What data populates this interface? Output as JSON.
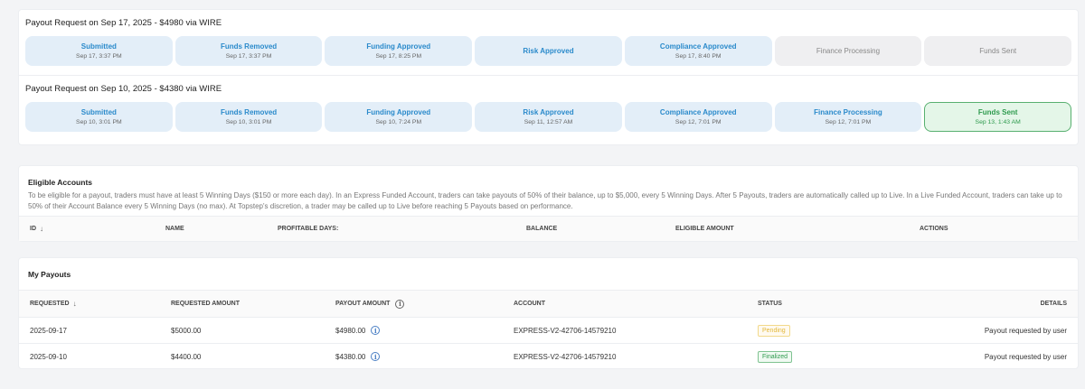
{
  "payout_requests": [
    {
      "title": "Payout Request on Sep 17, 2025 - $4980 via WIRE",
      "steps": [
        {
          "label": "Submitted",
          "date": "Sep 17, 3:37 PM",
          "state": "done"
        },
        {
          "label": "Funds Removed",
          "date": "Sep 17, 3:37 PM",
          "state": "done"
        },
        {
          "label": "Funding Approved",
          "date": "Sep 17, 8:25 PM",
          "state": "done"
        },
        {
          "label": "Risk Approved",
          "date": "",
          "state": "done"
        },
        {
          "label": "Compliance Approved",
          "date": "Sep 17, 8:40 PM",
          "state": "done"
        },
        {
          "label": "Finance Processing",
          "date": "",
          "state": "pending"
        },
        {
          "label": "Funds Sent",
          "date": "",
          "state": "pending"
        }
      ]
    },
    {
      "title": "Payout Request on Sep 10, 2025 - $4380 via WIRE",
      "steps": [
        {
          "label": "Submitted",
          "date": "Sep 10, 3:01 PM",
          "state": "done"
        },
        {
          "label": "Funds Removed",
          "date": "Sep 10, 3:01 PM",
          "state": "done"
        },
        {
          "label": "Funding Approved",
          "date": "Sep 10, 7:24 PM",
          "state": "done"
        },
        {
          "label": "Risk Approved",
          "date": "Sep 11, 12:57 AM",
          "state": "done"
        },
        {
          "label": "Compliance Approved",
          "date": "Sep 12, 7:01 PM",
          "state": "done"
        },
        {
          "label": "Finance Processing",
          "date": "Sep 12, 7:01 PM",
          "state": "done"
        },
        {
          "label": "Funds Sent",
          "date": "Sep 13, 1:43 AM",
          "state": "sent"
        }
      ]
    }
  ],
  "eligible": {
    "title": "Eligible Accounts",
    "description": "To be eligible for a payout, traders must have at least 5 Winning Days ($150 or more each day). In an Express Funded Account, traders can take payouts of 50% of their balance, up to $5,000, every 5 Winning Days. After 5 Payouts, traders are automatically called up to Live. In a Live Funded Account, traders can take up to 50% of their Account Balance every 5 Winning Days (no max). At Topstep's discretion, a trader may be called up to Live before reaching 5 Payouts based on performance.",
    "columns": [
      "ID",
      "NAME",
      "PROFITABLE DAYS:",
      "BALANCE",
      "ELIGIBLE AMOUNT",
      "ACTIONS"
    ]
  },
  "payouts": {
    "title": "My Payouts",
    "columns": [
      "REQUESTED",
      "REQUESTED AMOUNT",
      "PAYOUT AMOUNT",
      "ACCOUNT",
      "STATUS",
      "DETAILS"
    ],
    "rows": [
      {
        "requested": "2025-09-17",
        "requested_amount": "$5000.00",
        "payout_amount": "$4980.00",
        "account": "EXPRESS-V2-42706-14579210",
        "status": "Pending",
        "details": "Payout requested by user"
      },
      {
        "requested": "2025-09-10",
        "requested_amount": "$4400.00",
        "payout_amount": "$4380.00",
        "account": "EXPRESS-V2-42706-14579210",
        "status": "Finalized",
        "details": "Payout requested by user"
      }
    ]
  },
  "icons": {
    "sort": "arrow-down-icon",
    "info": "info-circle-icon"
  },
  "colors": {
    "accent_blue": "#2a8acb",
    "success_green": "#2d9a4d",
    "pending_yellow": "#e3b83a"
  }
}
